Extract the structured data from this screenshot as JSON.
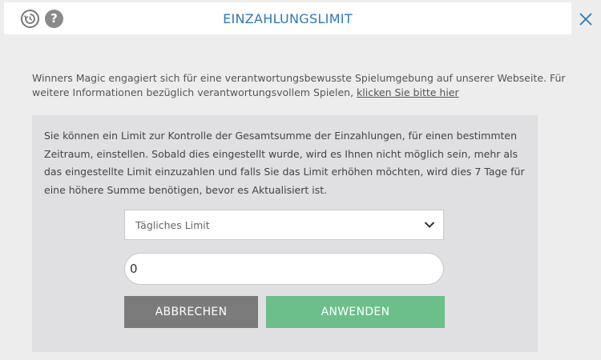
{
  "header": {
    "title": "EINZAHLUNGSLIMIT",
    "history_icon": "history-icon",
    "help_icon": "help-icon",
    "help_glyph": "?",
    "close_icon": "close-icon"
  },
  "intro": {
    "text": "Winners Magic engagiert sich für eine verantwortungsbewusste Spielumgebung auf unserer Webseite. Für weitere Informationen bezüglich verantwortungsvollem Spielen, ",
    "link_label": "klicken Sie bitte hier"
  },
  "panel": {
    "description": "Sie können ein Limit zur Kontrolle der Gesamtsumme der Einzahlungen, für einen bestimmten Zeitraum, einstellen. Sobald dies eingestellt wurde, wird es Ihnen nicht möglich sein, mehr als das eingestellte Limit einzuzahlen und falls Sie das Limit erhöhen möchten, wird dies 7 Tage für eine höhere Summe benötigen, bevor es Aktualisiert ist.",
    "period_select": {
      "selected": "Tägliches Limit",
      "icon": "chevron-down-icon"
    },
    "amount_value": "0",
    "cancel_label": "ABBRECHEN",
    "apply_label": "ANWENDEN"
  },
  "colors": {
    "title": "#2f77b4",
    "cancel_button": "#7b7b7b",
    "apply_button": "#6bbf89",
    "panel_bg": "#e0dfe1"
  }
}
